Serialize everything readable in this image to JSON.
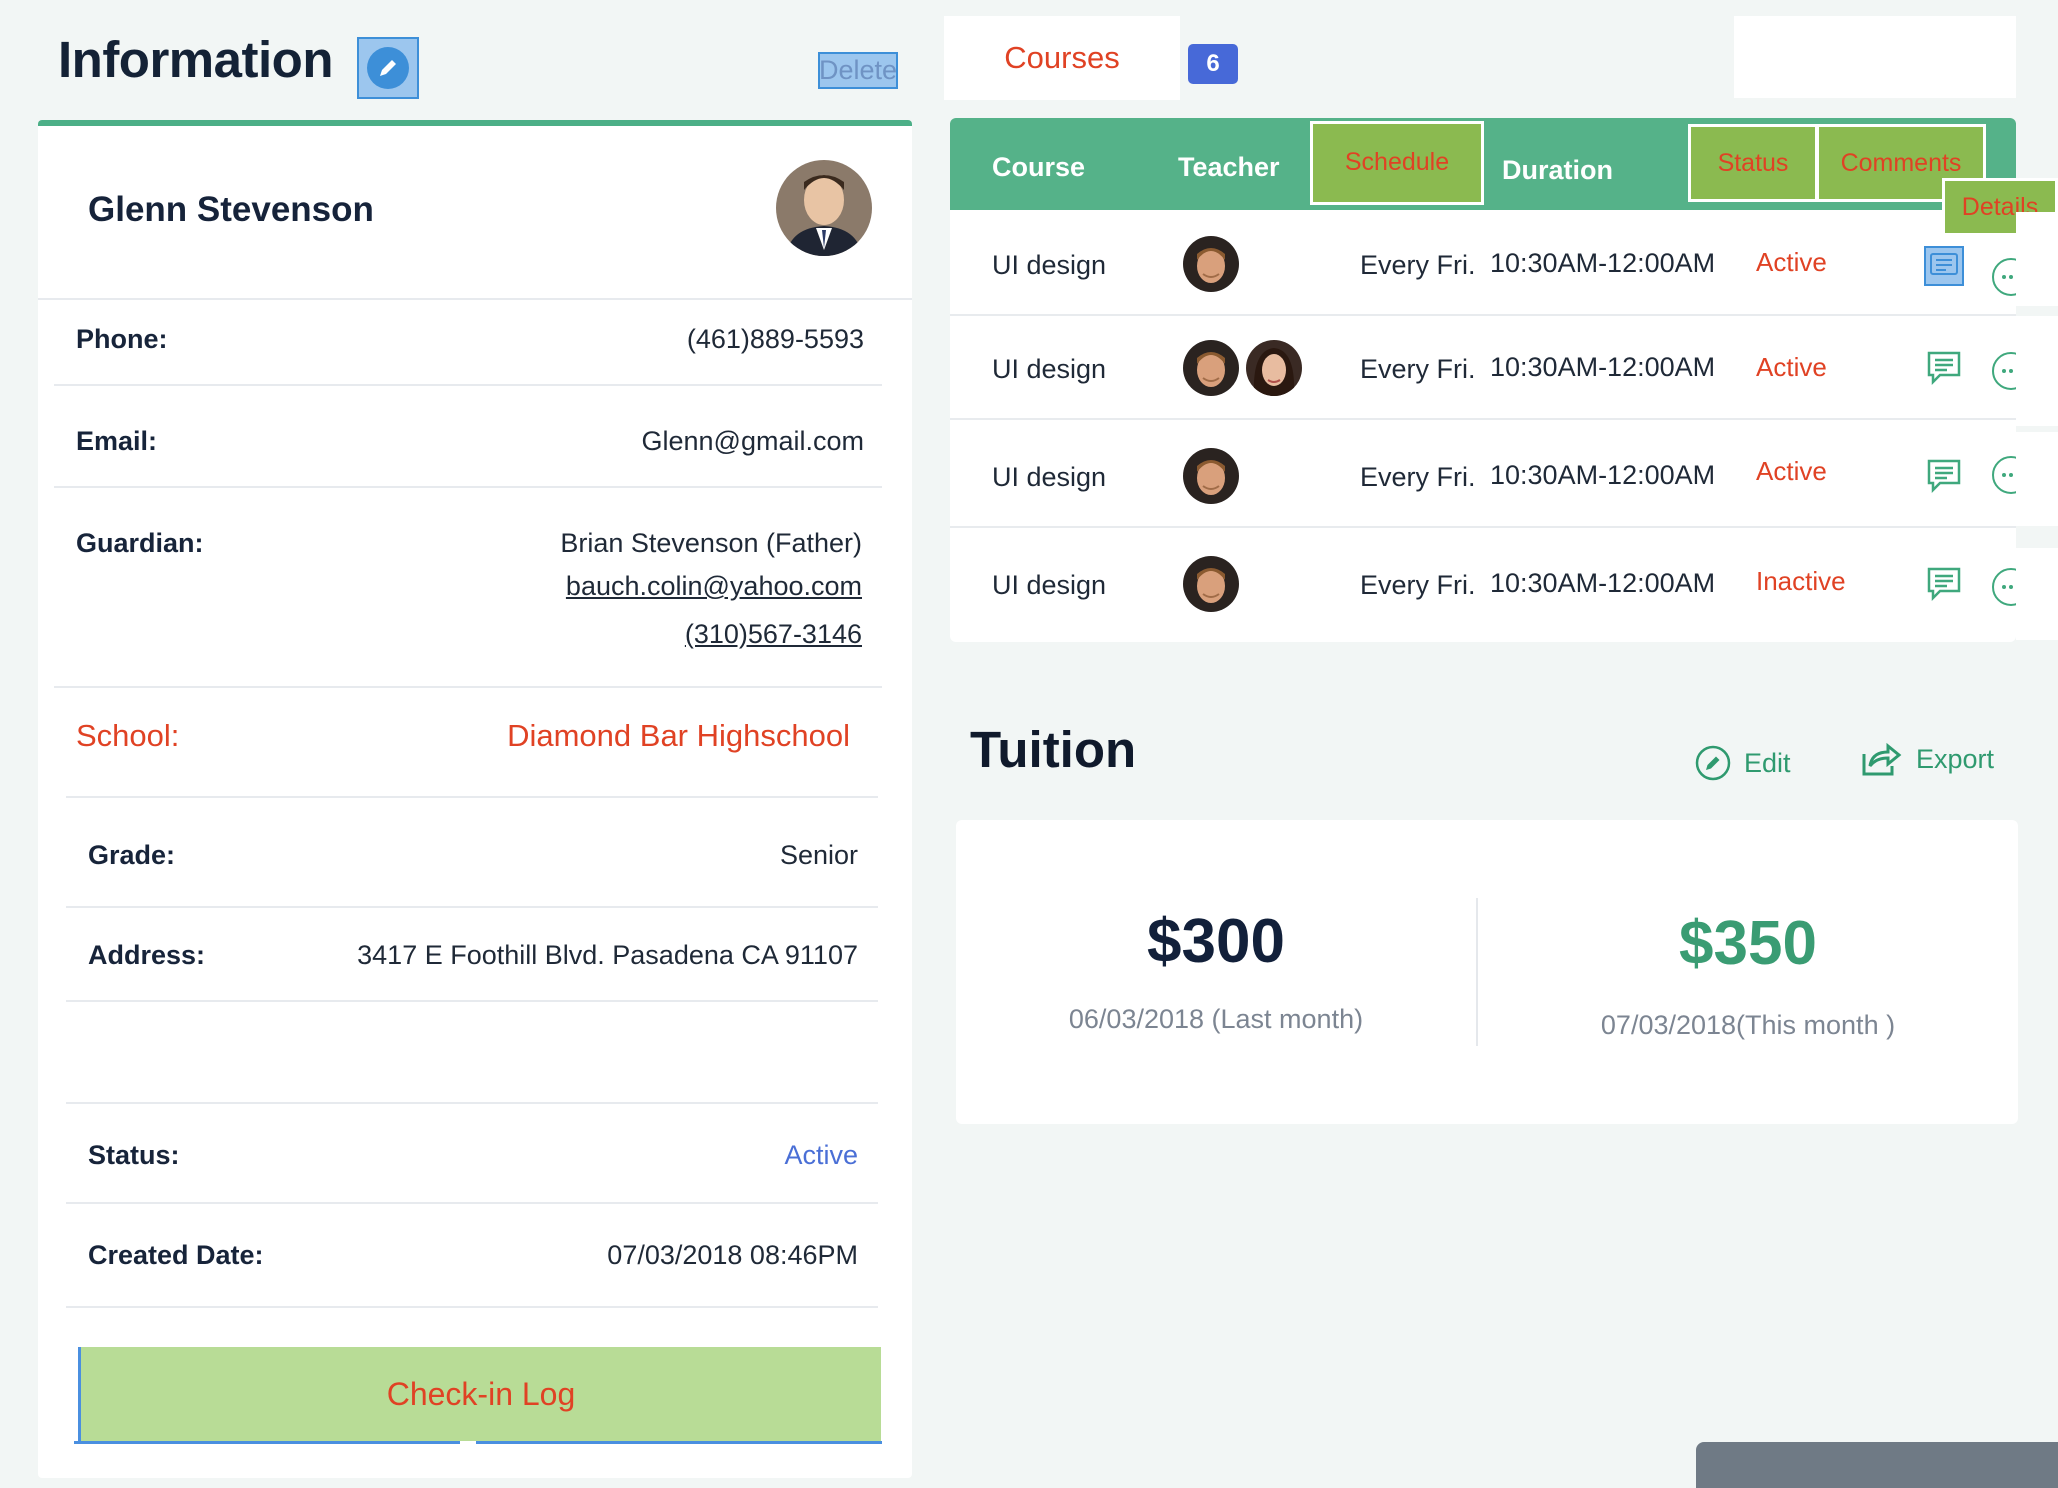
{
  "info": {
    "title": "Information",
    "delete_label": "Delete",
    "student_name": "Glenn Stevenson",
    "phone_label": "Phone:",
    "phone": "(461)889-5593",
    "email_label": "Email:",
    "email": "Glenn@gmail.com",
    "guardian_label": "Guardian:",
    "guardian_name": "Brian Stevenson (Father)",
    "guardian_email": "bauch.colin@yahoo.com",
    "guardian_phone": "(310)567-3146",
    "school_label": "School:",
    "school": "Diamond Bar Highschool",
    "grade_label": "Grade:",
    "grade": "Senior",
    "address_label": "Address:",
    "address": "3417 E Foothill Blvd. Pasadena CA 91107",
    "status_label": "Status:",
    "status": "Active",
    "created_label": "Created Date:",
    "created": "07/03/2018  08:46PM",
    "checkin_label": "Check-in Log"
  },
  "courses": {
    "tab_label": "Courses",
    "count": "6",
    "headers": {
      "course": "Course",
      "teacher": "Teacher",
      "schedule": "Schedule",
      "duration": "Duration",
      "status": "Status",
      "comments": "Comments",
      "details": "Details"
    },
    "rows": [
      {
        "course": "UI design",
        "schedule": "Every Fri.",
        "duration": "10:30AM-12:00AM",
        "status": "Active"
      },
      {
        "course": "UI design",
        "schedule": "Every Fri.",
        "duration": "10:30AM-12:00AM",
        "status": "Active"
      },
      {
        "course": "UI design",
        "schedule": "Every Fri.",
        "duration": "10:30AM-12:00AM",
        "status": "Active"
      },
      {
        "course": "UI design",
        "schedule": "Every Fri.",
        "duration": "10:30AM-12:00AM",
        "status": "Inactive"
      }
    ]
  },
  "tuition": {
    "title": "Tuition",
    "edit_label": "Edit",
    "export_label": "Export",
    "last_amount": "$300",
    "last_date": "06/03/2018 (Last month)",
    "this_amount": "$350",
    "this_date": "07/03/2018(This month )"
  },
  "colors": {
    "accent_green": "#55b289",
    "alert_red": "#e04224",
    "link_blue": "#4a6fd6"
  }
}
